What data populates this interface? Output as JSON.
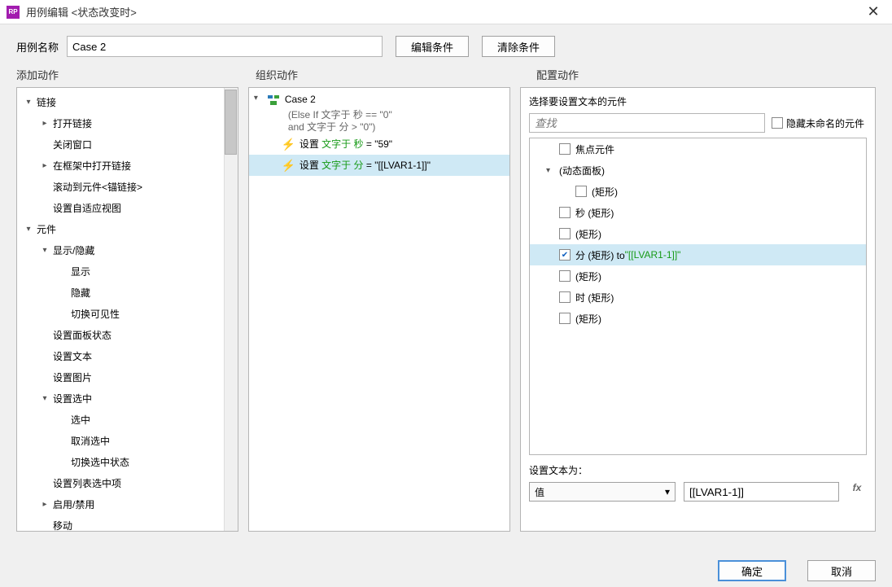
{
  "titlebar": {
    "title": "用例编辑 <状态改变时>"
  },
  "top": {
    "name_label": "用例名称",
    "case_name": "Case 2",
    "edit_cond": "编辑条件",
    "clear_cond": "清除条件"
  },
  "section_headers": {
    "left": "添加动作",
    "center": "组织动作",
    "right": "配置动作"
  },
  "action_tree": [
    {
      "lvl": 1,
      "toggle": "open",
      "label": "链接"
    },
    {
      "lvl": 2,
      "toggle": "right",
      "label": "打开链接"
    },
    {
      "lvl": 2,
      "toggle": "none",
      "label": "关闭窗口"
    },
    {
      "lvl": 2,
      "toggle": "right",
      "label": "在框架中打开链接"
    },
    {
      "lvl": 2,
      "toggle": "none",
      "label": "滚动到元件<锚链接>"
    },
    {
      "lvl": 2,
      "toggle": "none",
      "label": "设置自适应视图"
    },
    {
      "lvl": 1,
      "toggle": "open",
      "label": "元件"
    },
    {
      "lvl": 2,
      "toggle": "open",
      "label": "显示/隐藏"
    },
    {
      "lvl": 3,
      "toggle": "none",
      "label": "显示"
    },
    {
      "lvl": 3,
      "toggle": "none",
      "label": "隐藏"
    },
    {
      "lvl": 3,
      "toggle": "none",
      "label": "切换可见性"
    },
    {
      "lvl": 2,
      "toggle": "none",
      "label": "设置面板状态"
    },
    {
      "lvl": 2,
      "toggle": "none",
      "label": "设置文本"
    },
    {
      "lvl": 2,
      "toggle": "none",
      "label": "设置图片"
    },
    {
      "lvl": 2,
      "toggle": "open",
      "label": "设置选中"
    },
    {
      "lvl": 3,
      "toggle": "none",
      "label": "选中"
    },
    {
      "lvl": 3,
      "toggle": "none",
      "label": "取消选中"
    },
    {
      "lvl": 3,
      "toggle": "none",
      "label": "切换选中状态"
    },
    {
      "lvl": 2,
      "toggle": "none",
      "label": "设置列表选中项"
    },
    {
      "lvl": 2,
      "toggle": "right",
      "label": "启用/禁用"
    },
    {
      "lvl": 2,
      "toggle": "none",
      "label": "移动"
    }
  ],
  "case": {
    "name": "Case 2",
    "cond1": "(Else If 文字于 秒 == \"0\"",
    "cond2": "and 文字于 分 > \"0\")",
    "actions": [
      {
        "prefix": "设置 ",
        "green": "文字于 秒",
        "rest": " = \"59\"",
        "selected": false
      },
      {
        "prefix": "设置 ",
        "green": "文字于 分",
        "rest": " = \"[[LVAR1-1]]\"",
        "selected": true
      }
    ]
  },
  "right": {
    "title": "选择要设置文本的元件",
    "search_ph": "查找",
    "hide_unnamed": "隐藏未命名的元件",
    "widgets": [
      {
        "lvl": 1,
        "toggle": "none",
        "checked": false,
        "label": "焦点元件"
      },
      {
        "lvl": 1,
        "toggle": "open",
        "checked": null,
        "label": "(动态面板)"
      },
      {
        "lvl": 2,
        "toggle": "none",
        "checked": false,
        "label": "(矩形)"
      },
      {
        "lvl": 1,
        "toggle": "none",
        "checked": false,
        "label": "秒 (矩形)"
      },
      {
        "lvl": 1,
        "toggle": "none",
        "checked": false,
        "label": "(矩形)"
      },
      {
        "lvl": 1,
        "toggle": "none",
        "checked": true,
        "label": "分 (矩形) to ",
        "green": "\"[[LVAR1-1]]\"",
        "selected": true
      },
      {
        "lvl": 1,
        "toggle": "none",
        "checked": false,
        "label": "(矩形)"
      },
      {
        "lvl": 1,
        "toggle": "none",
        "checked": false,
        "label": "时 (矩形)"
      },
      {
        "lvl": 1,
        "toggle": "none",
        "checked": false,
        "label": "(矩形)"
      }
    ],
    "set_text_label": "设置文本为：",
    "dropdown_value": "值",
    "value_input": "[[LVAR1-1]]",
    "fx": "fx"
  },
  "footer": {
    "ok": "确定",
    "cancel": "取消"
  }
}
